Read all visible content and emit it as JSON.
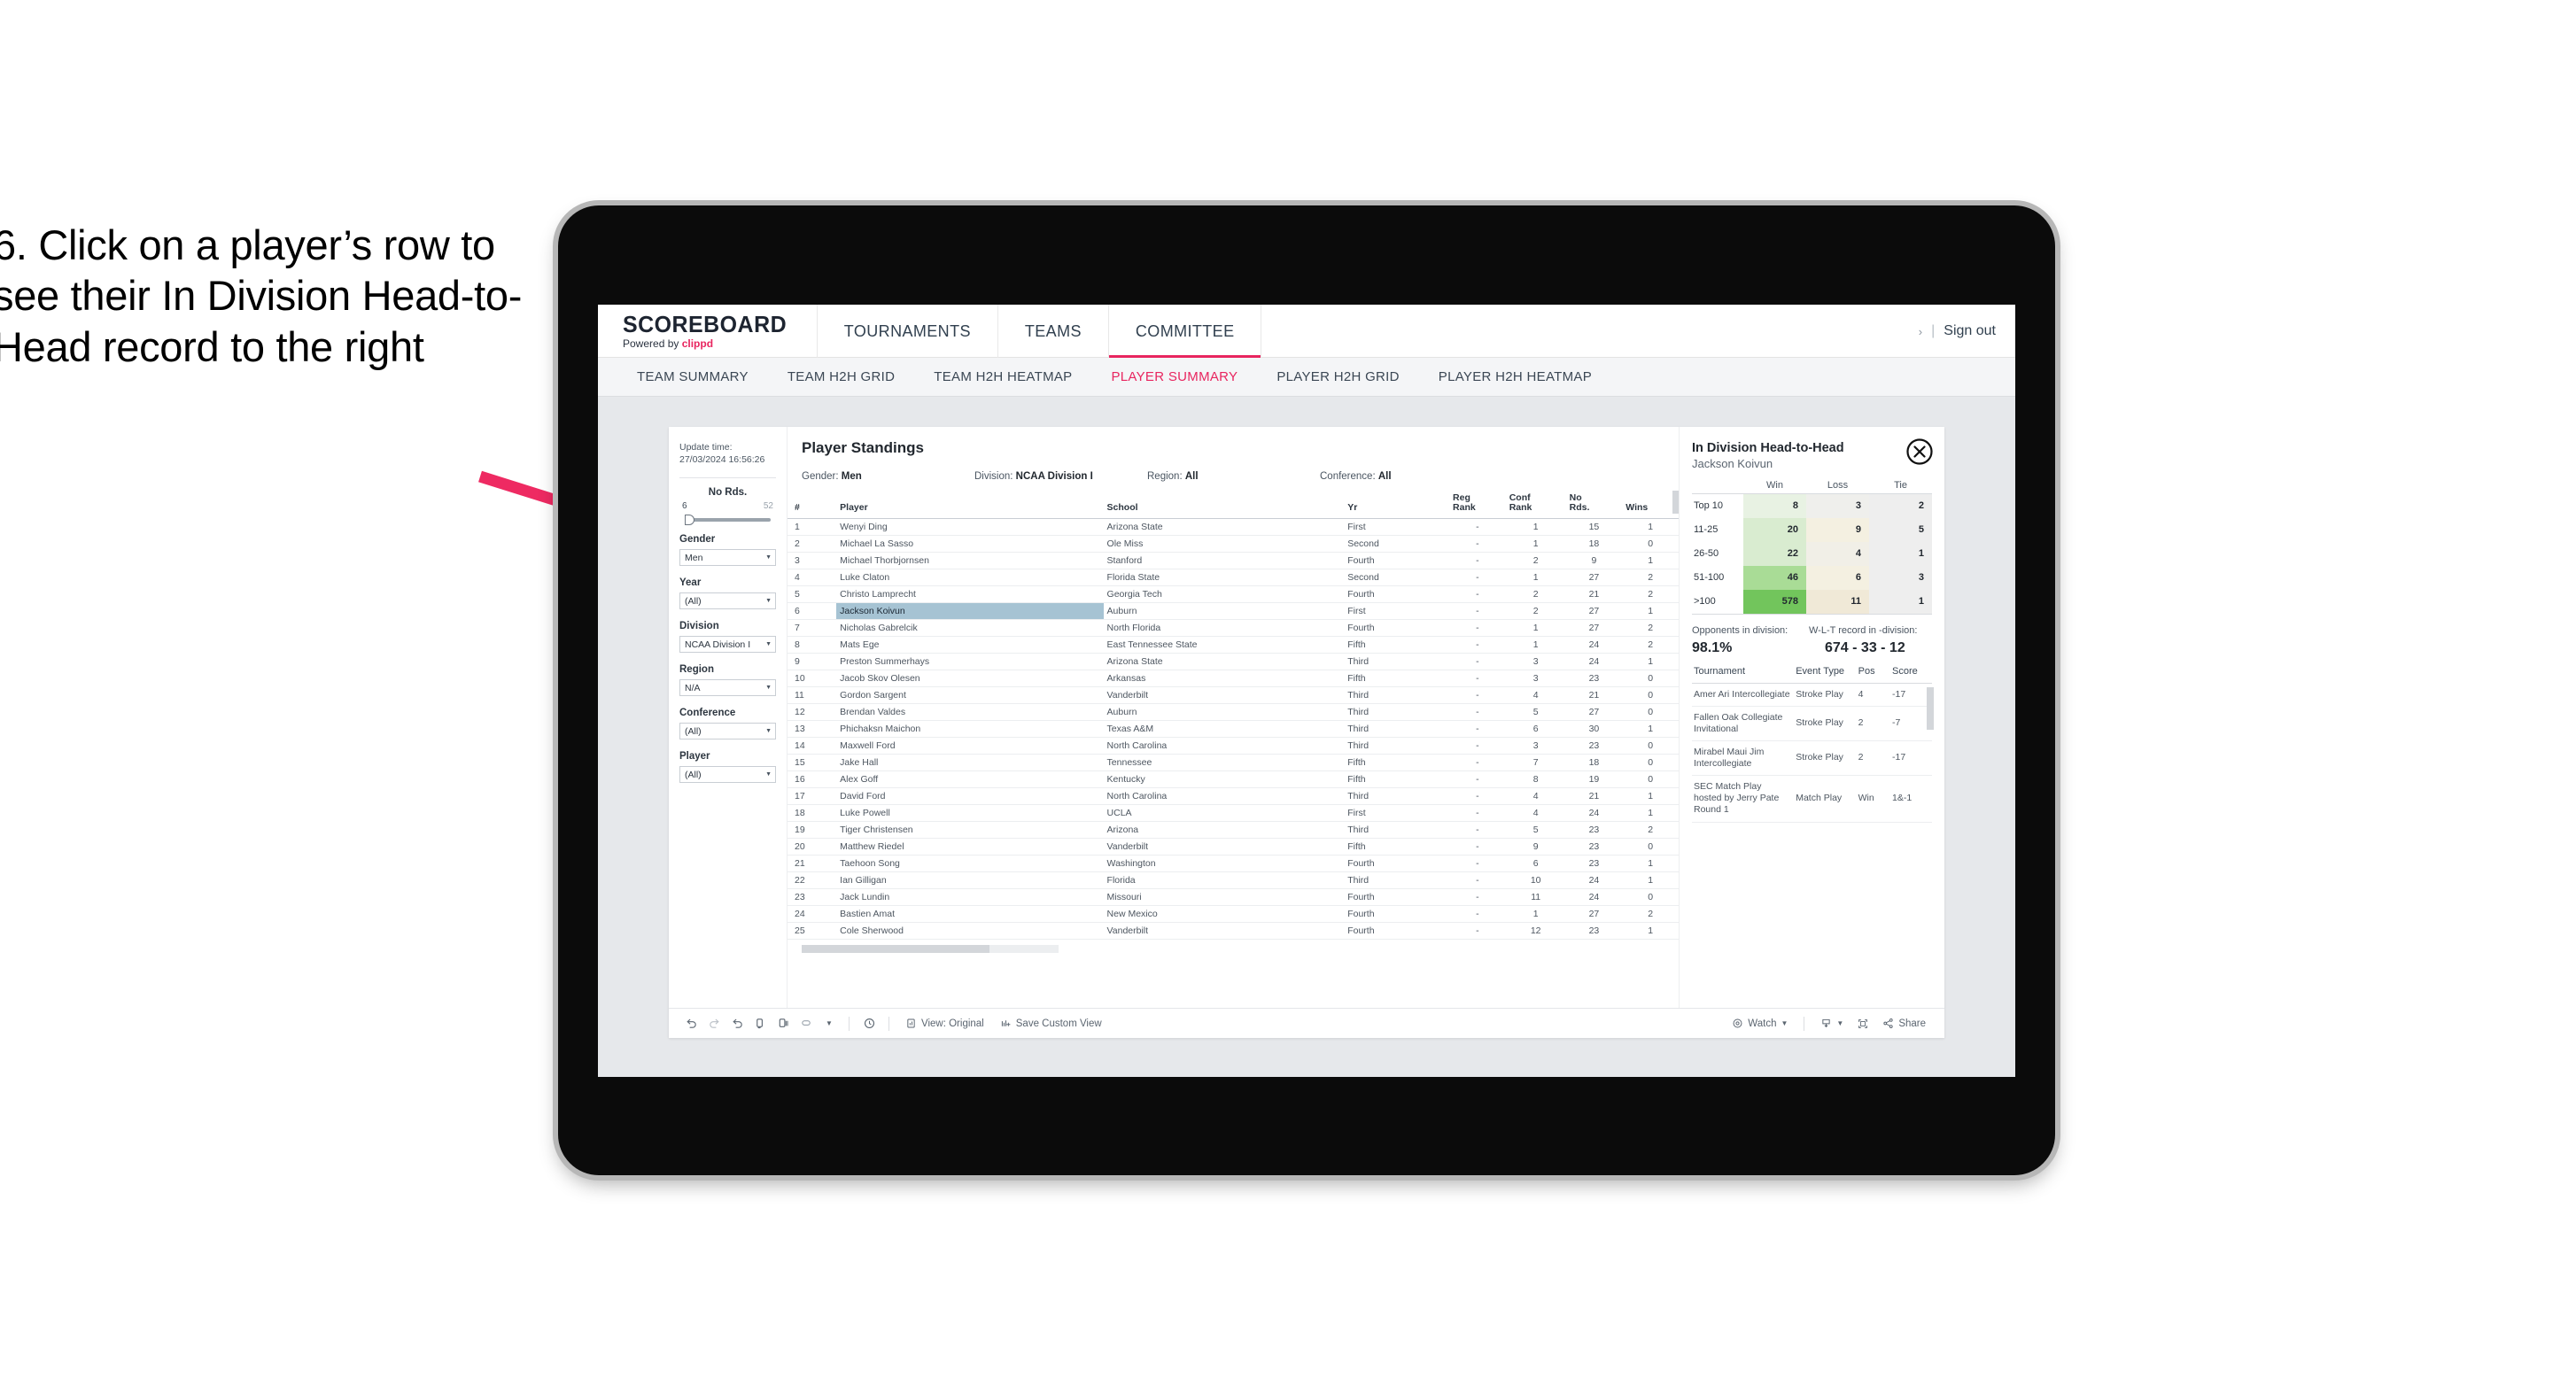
{
  "instruction": "6. Click on a player’s row to see their In Division Head-to-Head record to the right",
  "header": {
    "brand_title": "SCOREBOARD",
    "brand_powered": "Powered by",
    "brand_name": "clippd",
    "nav": [
      {
        "label": "TOURNAMENTS",
        "active": false
      },
      {
        "label": "TEAMS",
        "active": false
      },
      {
        "label": "COMMITTEE",
        "active": true
      }
    ],
    "right_dot": "›",
    "right_bar": "|",
    "sign_out": "Sign out"
  },
  "subnav": [
    {
      "label": "TEAM SUMMARY",
      "active": false
    },
    {
      "label": "TEAM H2H GRID",
      "active": false
    },
    {
      "label": "TEAM H2H HEATMAP",
      "active": false
    },
    {
      "label": "PLAYER SUMMARY",
      "active": true
    },
    {
      "label": "PLAYER H2H GRID",
      "active": false
    },
    {
      "label": "PLAYER H2H HEATMAP",
      "active": false
    }
  ],
  "filters": {
    "update_label": "Update time:",
    "update_value": "27/03/2024 16:56:26",
    "slider": {
      "title": "No Rds.",
      "min": "6",
      "max": "52"
    },
    "groups": [
      {
        "title": "Gender",
        "value": "Men"
      },
      {
        "title": "Year",
        "value": "(All)"
      },
      {
        "title": "Division",
        "value": "NCAA Division I"
      },
      {
        "title": "Region",
        "value": "N/A"
      },
      {
        "title": "Conference",
        "value": "(All)"
      },
      {
        "title": "Player",
        "value": "(All)"
      }
    ]
  },
  "standings": {
    "title": "Player Standings",
    "summary": [
      {
        "key": "Gender:",
        "value": "Men"
      },
      {
        "key": "Division:",
        "value": "NCAA Division I"
      },
      {
        "key": "Region:",
        "value": "All"
      },
      {
        "key": "Conference:",
        "value": "All"
      }
    ],
    "columns": [
      "#",
      "Player",
      "School",
      "Yr",
      "Reg Rank",
      "Conf Rank",
      "No Rds.",
      "Wins"
    ],
    "rows": [
      {
        "rank": "1",
        "player": "Wenyi Ding",
        "school": "Arizona State",
        "yr": "First",
        "reg": "-",
        "conf": "1",
        "rds": "15",
        "wins": "1",
        "selected": false
      },
      {
        "rank": "2",
        "player": "Michael La Sasso",
        "school": "Ole Miss",
        "yr": "Second",
        "reg": "-",
        "conf": "1",
        "rds": "18",
        "wins": "0",
        "selected": false
      },
      {
        "rank": "3",
        "player": "Michael Thorbjornsen",
        "school": "Stanford",
        "yr": "Fourth",
        "reg": "-",
        "conf": "2",
        "rds": "9",
        "wins": "1",
        "selected": false
      },
      {
        "rank": "4",
        "player": "Luke Claton",
        "school": "Florida State",
        "yr": "Second",
        "reg": "-",
        "conf": "1",
        "rds": "27",
        "wins": "2",
        "selected": false
      },
      {
        "rank": "5",
        "player": "Christo Lamprecht",
        "school": "Georgia Tech",
        "yr": "Fourth",
        "reg": "-",
        "conf": "2",
        "rds": "21",
        "wins": "2",
        "selected": false
      },
      {
        "rank": "6",
        "player": "Jackson Koivun",
        "school": "Auburn",
        "yr": "First",
        "reg": "-",
        "conf": "2",
        "rds": "27",
        "wins": "1",
        "selected": true
      },
      {
        "rank": "7",
        "player": "Nicholas Gabrelcik",
        "school": "North Florida",
        "yr": "Fourth",
        "reg": "-",
        "conf": "1",
        "rds": "27",
        "wins": "2",
        "selected": false
      },
      {
        "rank": "8",
        "player": "Mats Ege",
        "school": "East Tennessee State",
        "yr": "Fifth",
        "reg": "-",
        "conf": "1",
        "rds": "24",
        "wins": "2",
        "selected": false
      },
      {
        "rank": "9",
        "player": "Preston Summerhays",
        "school": "Arizona State",
        "yr": "Third",
        "reg": "-",
        "conf": "3",
        "rds": "24",
        "wins": "1",
        "selected": false
      },
      {
        "rank": "10",
        "player": "Jacob Skov Olesen",
        "school": "Arkansas",
        "yr": "Fifth",
        "reg": "-",
        "conf": "3",
        "rds": "23",
        "wins": "0",
        "selected": false
      },
      {
        "rank": "11",
        "player": "Gordon Sargent",
        "school": "Vanderbilt",
        "yr": "Third",
        "reg": "-",
        "conf": "4",
        "rds": "21",
        "wins": "0",
        "selected": false
      },
      {
        "rank": "12",
        "player": "Brendan Valdes",
        "school": "Auburn",
        "yr": "Third",
        "reg": "-",
        "conf": "5",
        "rds": "27",
        "wins": "0",
        "selected": false
      },
      {
        "rank": "13",
        "player": "Phichaksn Maichon",
        "school": "Texas A&M",
        "yr": "Third",
        "reg": "-",
        "conf": "6",
        "rds": "30",
        "wins": "1",
        "selected": false
      },
      {
        "rank": "14",
        "player": "Maxwell Ford",
        "school": "North Carolina",
        "yr": "Third",
        "reg": "-",
        "conf": "3",
        "rds": "23",
        "wins": "0",
        "selected": false
      },
      {
        "rank": "15",
        "player": "Jake Hall",
        "school": "Tennessee",
        "yr": "Fifth",
        "reg": "-",
        "conf": "7",
        "rds": "18",
        "wins": "0",
        "selected": false
      },
      {
        "rank": "16",
        "player": "Alex Goff",
        "school": "Kentucky",
        "yr": "Fifth",
        "reg": "-",
        "conf": "8",
        "rds": "19",
        "wins": "0",
        "selected": false
      },
      {
        "rank": "17",
        "player": "David Ford",
        "school": "North Carolina",
        "yr": "Third",
        "reg": "-",
        "conf": "4",
        "rds": "21",
        "wins": "1",
        "selected": false
      },
      {
        "rank": "18",
        "player": "Luke Powell",
        "school": "UCLA",
        "yr": "First",
        "reg": "-",
        "conf": "4",
        "rds": "24",
        "wins": "1",
        "selected": false
      },
      {
        "rank": "19",
        "player": "Tiger Christensen",
        "school": "Arizona",
        "yr": "Third",
        "reg": "-",
        "conf": "5",
        "rds": "23",
        "wins": "2",
        "selected": false
      },
      {
        "rank": "20",
        "player": "Matthew Riedel",
        "school": "Vanderbilt",
        "yr": "Fifth",
        "reg": "-",
        "conf": "9",
        "rds": "23",
        "wins": "0",
        "selected": false
      },
      {
        "rank": "21",
        "player": "Taehoon Song",
        "school": "Washington",
        "yr": "Fourth",
        "reg": "-",
        "conf": "6",
        "rds": "23",
        "wins": "1",
        "selected": false
      },
      {
        "rank": "22",
        "player": "Ian Gilligan",
        "school": "Florida",
        "yr": "Third",
        "reg": "-",
        "conf": "10",
        "rds": "24",
        "wins": "1",
        "selected": false
      },
      {
        "rank": "23",
        "player": "Jack Lundin",
        "school": "Missouri",
        "yr": "Fourth",
        "reg": "-",
        "conf": "11",
        "rds": "24",
        "wins": "0",
        "selected": false
      },
      {
        "rank": "24",
        "player": "Bastien Amat",
        "school": "New Mexico",
        "yr": "Fourth",
        "reg": "-",
        "conf": "1",
        "rds": "27",
        "wins": "2",
        "selected": false
      },
      {
        "rank": "25",
        "player": "Cole Sherwood",
        "school": "Vanderbilt",
        "yr": "Fourth",
        "reg": "-",
        "conf": "12",
        "rds": "23",
        "wins": "1",
        "selected": false
      }
    ]
  },
  "detail": {
    "title": "In Division Head-to-Head",
    "player": "Jackson Koivun",
    "close_icon": "close-circle-icon",
    "h2h_columns": [
      "Win",
      "Loss",
      "Tie"
    ],
    "h2h_rows": [
      {
        "bucket": "Top 10",
        "win": "8",
        "loss": "3",
        "tie": "2",
        "win_color": "#e8f2e3",
        "loss_color": "#efefec",
        "tie_color": "#eeeeee"
      },
      {
        "bucket": "11-25",
        "win": "20",
        "loss": "9",
        "tie": "5",
        "win_color": "#d9ecd0",
        "loss_color": "#f4f0e1",
        "tie_color": "#eeeeee"
      },
      {
        "bucket": "26-50",
        "win": "22",
        "loss": "4",
        "tie": "1",
        "win_color": "#d9ecd0",
        "loss_color": "#f1efe7",
        "tie_color": "#eeeeee"
      },
      {
        "bucket": "51-100",
        "win": "46",
        "loss": "6",
        "tie": "3",
        "win_color": "#a9dc96",
        "loss_color": "#f4f0e1",
        "tie_color": "#eeeeee"
      },
      {
        "bucket": ">100",
        "win": "578",
        "loss": "11",
        "tie": "1",
        "win_color": "#72c55c",
        "loss_color": "#f0e9d7",
        "tie_color": "#eeeeee"
      }
    ],
    "stats": [
      {
        "label": "Opponents in division:",
        "value": "98.1%"
      },
      {
        "label": "W-L-T record in -division:",
        "value": "674 - 33 - 12"
      }
    ],
    "tourn_columns": [
      "Tournament",
      "Event Type",
      "Pos",
      "Score"
    ],
    "tournaments": [
      {
        "name": "Amer Ari Intercollegiate",
        "type": "Stroke Play",
        "pos": "4",
        "score": "-17"
      },
      {
        "name": "Fallen Oak Collegiate Invitational",
        "type": "Stroke Play",
        "pos": "2",
        "score": "-7"
      },
      {
        "name": "Mirabel Maui Jim Intercollegiate",
        "type": "Stroke Play",
        "pos": "2",
        "score": "-17"
      },
      {
        "name": "SEC Match Play hosted by Jerry Pate Round 1",
        "type": "Match Play",
        "pos": "Win",
        "score": "1&-1"
      }
    ]
  },
  "toolbar": {
    "view_label": "View: Original",
    "save_label": "Save Custom View",
    "watch_label": "Watch",
    "share_label": "Share",
    "icons": [
      "undo-icon",
      "redo-icon",
      "revert-icon",
      "refresh-data-icon",
      "pause-updates-icon",
      "highlight-icon",
      "dropdown-caret-icon",
      "alert-clock-icon",
      "view-original-icon",
      "save-custom-view-icon",
      "watch-icon",
      "download-icon",
      "full-screen-icon",
      "share-icon"
    ]
  },
  "chart_data": {
    "type": "heatmap",
    "title": "In Division Head-to-Head",
    "subtitle": "Jackson Koivun",
    "rows": [
      "Top 10",
      "11-25",
      "26-50",
      "51-100",
      ">100"
    ],
    "columns": [
      "Win",
      "Loss",
      "Tie"
    ],
    "values": [
      [
        8,
        3,
        2
      ],
      [
        20,
        9,
        5
      ],
      [
        22,
        4,
        1
      ],
      [
        46,
        6,
        3
      ],
      [
        578,
        11,
        1
      ]
    ],
    "xlabel": "",
    "ylabel": "Opponent rank bucket",
    "legend": "none",
    "grid": false,
    "totals": {
      "opponents_in_division_pct": 98.1,
      "record_w": 674,
      "record_l": 33,
      "record_t": 12
    }
  }
}
